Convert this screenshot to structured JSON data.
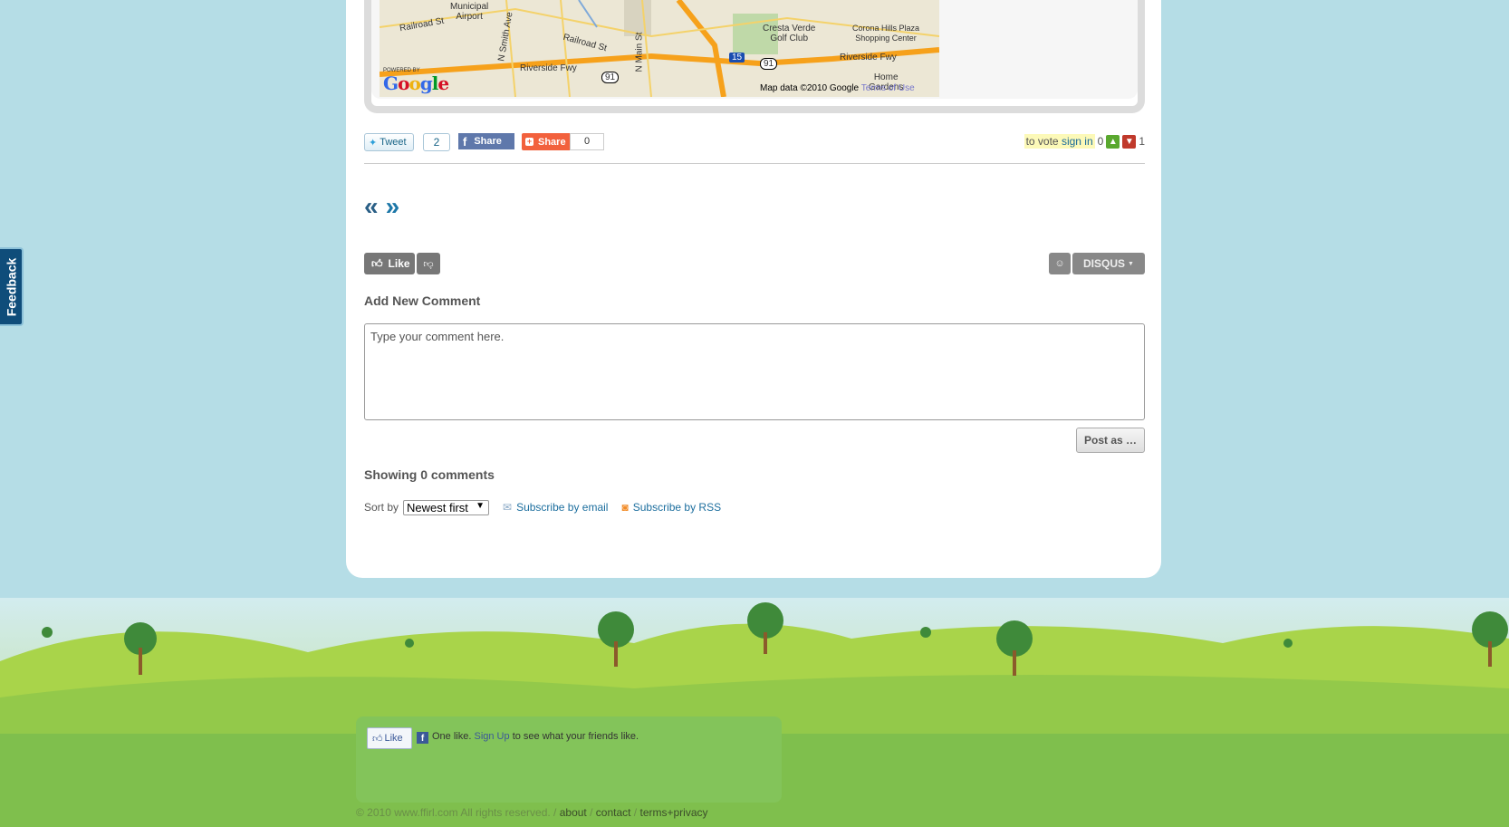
{
  "feedback": {
    "label": "Feedback"
  },
  "map": {
    "labels": {
      "municipal_airport": "Municipal\nAirport",
      "railroad_st": "Railroad St",
      "n_smith_ave": "N Smith Ave",
      "railroad_st_2": "Railroad St",
      "n_main_st": "N Main St",
      "cresta_verde": "Cresta Verde\nGolf Club",
      "corona_hills": "Corona Hills Plaza\nShopping Center",
      "riverside_fwy": "Riverside Fwy",
      "riverside_fwy_2": "Riverside Fwy",
      "home_gardens": "Home\nGardens",
      "highway_91": "91",
      "highway_15": "15"
    },
    "powered_by": "POWERED BY",
    "logo": "Google",
    "footer_data": "Map data ©2010 Google",
    "footer_terms": "Terms of Use"
  },
  "share": {
    "tweet_label": "Tweet",
    "tweet_count": "2",
    "fb_share_label": "Share",
    "addthis_label": "Share",
    "addthis_count": "0"
  },
  "vote": {
    "prefix": "to vote",
    "signin": "sign in",
    "up_count": "0",
    "down_count": "1"
  },
  "pager": {
    "prev": "«",
    "next": "»"
  },
  "disqus": {
    "like_label": "Like",
    "brand_label": "DISQUS",
    "add_comment_title": "Add New Comment",
    "comment_placeholder": "Type your comment here.",
    "post_button": "Post as …",
    "showing": "Showing 0 comments",
    "sort_label": "Sort by",
    "sort_value": "Newest first",
    "subscribe_email": "Subscribe by email",
    "subscribe_rss": "Subscribe by RSS"
  },
  "footer": {
    "fb_like_label": "Like",
    "fb_like_text_prefix": "One like.",
    "fb_signup": "Sign Up",
    "fb_like_text_suffix": "to see what your friends like.",
    "copyright": "© 2010 www.ffirl.com All rights reserved. /",
    "about": "about",
    "contact": "contact",
    "terms": "terms+privacy"
  },
  "colors": {
    "background": "#b5dde6",
    "link": "#1c6e9e",
    "grass": "#83c45a",
    "feedback_tab": "#0f4d7a"
  }
}
